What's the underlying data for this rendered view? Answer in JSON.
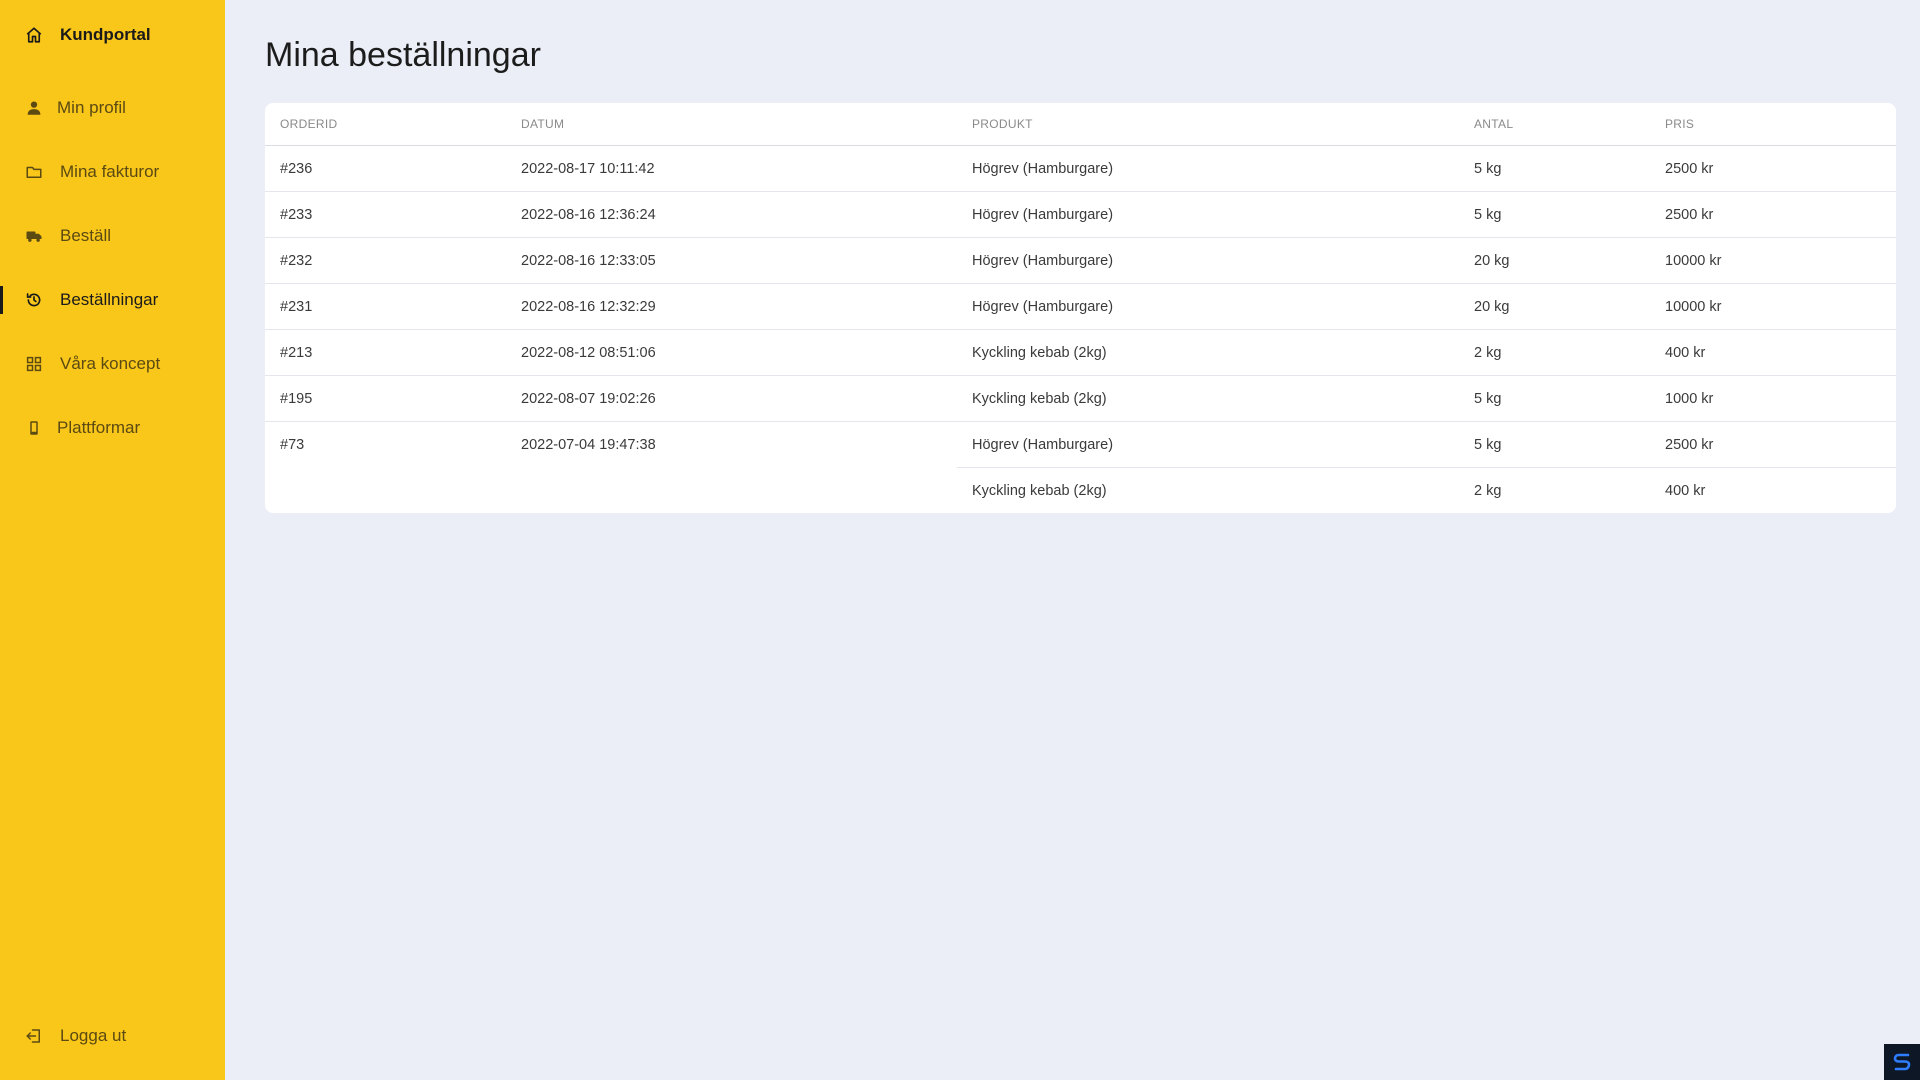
{
  "sidebar": {
    "brand": {
      "label": "Kundportal",
      "icon": "home-icon"
    },
    "items": [
      {
        "label": "Min profil",
        "icon": "user-icon"
      },
      {
        "label": "Mina fakturor",
        "icon": "folder-icon"
      },
      {
        "label": "Beställ",
        "icon": "truck-icon"
      },
      {
        "label": "Beställningar",
        "icon": "history-icon",
        "active": true
      },
      {
        "label": "Våra koncept",
        "icon": "grid-icon"
      },
      {
        "label": "Plattformar",
        "icon": "mobile-icon"
      }
    ],
    "logout": {
      "label": "Logga ut",
      "icon": "logout-icon"
    }
  },
  "main": {
    "title": "Mina beställningar",
    "table": {
      "headers": [
        "ORDERID",
        "DATUM",
        "PRODUKT",
        "ANTAL",
        "PRIS"
      ],
      "rows": [
        {
          "id": "#236",
          "date": "2022-08-17 10:11:42",
          "product": "Högrev (Hamburgare)",
          "qty": "5 kg",
          "price": "2500 kr"
        },
        {
          "id": "#233",
          "date": "2022-08-16 12:36:24",
          "product": "Högrev (Hamburgare)",
          "qty": "5 kg",
          "price": "2500 kr"
        },
        {
          "id": "#232",
          "date": "2022-08-16 12:33:05",
          "product": "Högrev (Hamburgare)",
          "qty": "20 kg",
          "price": "10000 kr"
        },
        {
          "id": "#231",
          "date": "2022-08-16 12:32:29",
          "product": "Högrev (Hamburgare)",
          "qty": "20 kg",
          "price": "10000 kr"
        },
        {
          "id": "#213",
          "date": "2022-08-12 08:51:06",
          "product": "Kyckling kebab (2kg)",
          "qty": "2 kg",
          "price": "400 kr"
        },
        {
          "id": "#195",
          "date": "2022-08-07 19:02:26",
          "product": "Kyckling kebab (2kg)",
          "qty": "5 kg",
          "price": "1000 kr"
        },
        {
          "id": "#73",
          "date": "2022-07-04 19:47:38",
          "product": "Högrev (Hamburgare)",
          "qty": "5 kg",
          "price": "2500 kr"
        },
        {
          "id": "",
          "date": "",
          "product": "Kyckling kebab (2kg)",
          "qty": "2 kg",
          "price": "400 kr"
        }
      ]
    }
  },
  "colors": {
    "sidebar_bg": "#f9c61a",
    "page_bg": "#ebeef7",
    "card_bg": "#ffffff"
  }
}
